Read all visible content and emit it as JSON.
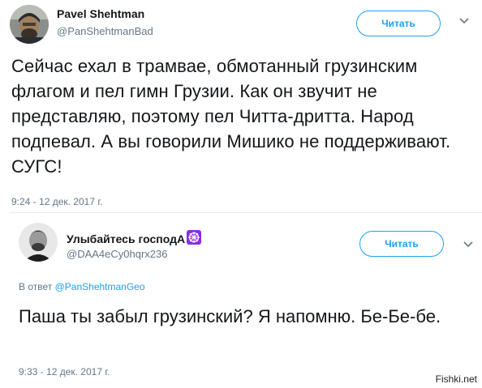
{
  "main_tweet": {
    "author_name": "Pavel Shehtman",
    "author_handle": "@PanShehtmanBad",
    "follow_label": "Читать",
    "text": "Сейчас ехал в трамвае, обмотанный грузинским флагом и пел гимн Грузии. Как он звучит не представляю, поэтому пел Читта-дритта. Народ подпевал. А вы говорили Мишико не поддерживают. СУГС!",
    "timestamp": "9:24 - 12 дек. 2017 г."
  },
  "reply_tweet": {
    "author_name": "Улыбайтесь господА",
    "author_handle": "@DAA4eCy0hqrx236",
    "follow_label": "Читать",
    "reply_prefix": "В ответ",
    "reply_to_handle": "@PanShehtmanGeo",
    "text": "Паша ты забыл грузинский? Я напомню. Бе-Бе-бе.",
    "timestamp": "9:33 - 12 дек. 2017 г."
  },
  "watermark": "Fishki.net",
  "colors": {
    "accent": "#1da1f2",
    "secondary_text": "#657786",
    "primary_text": "#14171a",
    "divider": "#e6ecf0",
    "dharma_wheel": "#8a2be2"
  },
  "icons": {
    "caret": "chevron-down-icon",
    "name_emoji": "dharma-wheel-icon"
  }
}
